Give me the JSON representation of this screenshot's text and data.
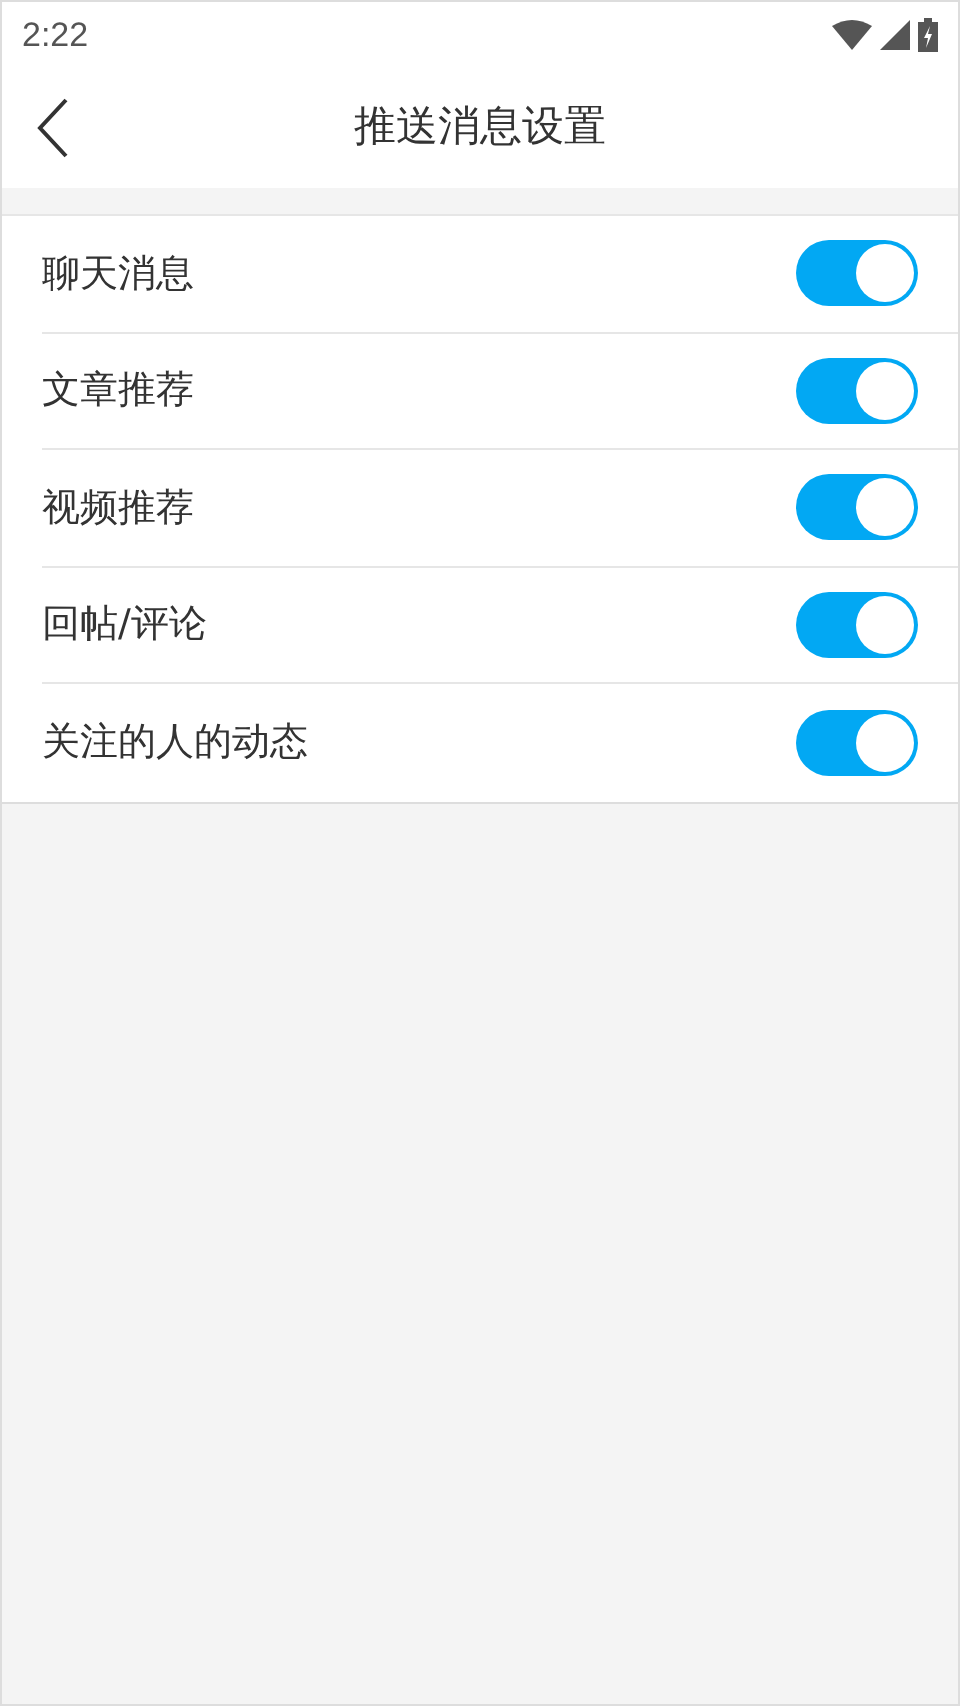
{
  "status_bar": {
    "time": "2:22"
  },
  "header": {
    "title": "推送消息设置"
  },
  "settings": [
    {
      "label": "聊天消息",
      "on": true
    },
    {
      "label": "文章推荐",
      "on": true
    },
    {
      "label": "视频推荐",
      "on": true
    },
    {
      "label": "回帖/评论",
      "on": true
    },
    {
      "label": "关注的人的动态",
      "on": true
    }
  ]
}
